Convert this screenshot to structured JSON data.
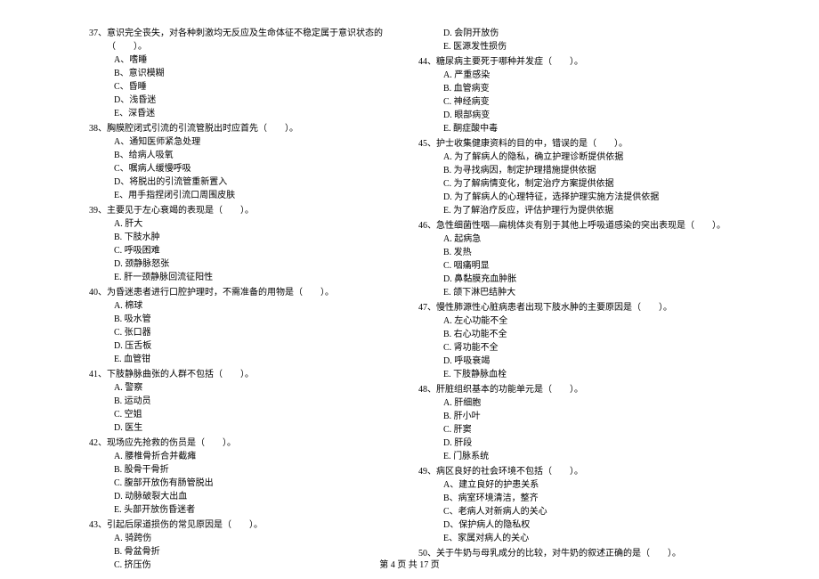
{
  "footer": "第 4 页 共 17 页",
  "left_column": [
    {
      "num": "37、",
      "text": "意识完全丧失，对各种刺激均无反应及生命体征不稳定属于意识状态的（　　）。",
      "options": [
        "A、嗜睡",
        "B、意识模糊",
        "C、昏睡",
        "D、浅昏迷",
        "E、深昏迷"
      ]
    },
    {
      "num": "38、",
      "text": "胸膜腔闭式引流的引流管脱出时应首先（　　）。",
      "options": [
        "A、通知医师紧急处理",
        "B、给病人吸氧",
        "C、嘱病人缓慢呼吸",
        "D、将脱出的引流管重新置入",
        "E、用手指捏闭引流口周围皮肤"
      ]
    },
    {
      "num": "39、",
      "text": "主要见于左心衰竭的表现是（　　）。",
      "options": [
        "A. 肝大",
        "B. 下肢水肿",
        "C. 呼吸困难",
        "D. 颈静脉怒张",
        "E. 肝一颈静脉回流征阳性"
      ]
    },
    {
      "num": "40、",
      "text": "为昏迷患者进行口腔护理时，不需准备的用物是（　　）。",
      "options": [
        "A. 棉球",
        "B. 吸水管",
        "C. 张口器",
        "D. 压舌板",
        "E. 血管钳"
      ]
    },
    {
      "num": "41、",
      "text": "下肢静脉曲张的人群不包括（　　）。",
      "options": [
        "A. 警察",
        "B. 运动员",
        "C. 空姐",
        "D. 医生"
      ]
    },
    {
      "num": "42、",
      "text": "现场应先抢救的伤员是（　　）。",
      "options": [
        "A. 腰椎骨折合并截瘫",
        "B. 股骨干骨折",
        "C. 腹部开放伤有肠管脱出",
        "D. 动脉破裂大出血",
        "E. 头部开放伤昏迷者"
      ]
    },
    {
      "num": "43、",
      "text": "引起后尿道损伤的常见原因是（　　）。",
      "options": [
        "A. 骑跨伤",
        "B. 骨盆骨折",
        "C. 挤压伤"
      ]
    }
  ],
  "right_column": [
    {
      "num": "",
      "text": "",
      "options": [
        "D. 会阴开放伤",
        "E. 医源发性损伤"
      ]
    },
    {
      "num": "44、",
      "text": "糖尿病主要死于哪种并发症（　　）。",
      "options": [
        "A. 严重感染",
        "B. 血管病变",
        "C. 神经病变",
        "D. 眼部病变",
        "E. 酮症酸中毒"
      ]
    },
    {
      "num": "45、",
      "text": "护士收集健康资料的目的中，错误的是（　　）。",
      "options": [
        "A. 为了解病人的隐私，确立护理诊断提供依据",
        "B. 为寻找病因，制定护理措施提供依据",
        "C. 为了解病情变化，制定治疗方案提供依据",
        "D. 为了解病人的心理特征，选择护理实施方法提供依据",
        "E. 为了解治疗反应，评估护理行为提供依据"
      ]
    },
    {
      "num": "46、",
      "text": "急性细菌性咽—扁桃体炎有别于其他上呼吸道感染的突出表现是（　　）。",
      "options": [
        "A. 起病急",
        "B. 发热",
        "C. 咽痛明显",
        "D. 鼻黏膜充血肿胀",
        "E. 颌下淋巴结肿大"
      ]
    },
    {
      "num": "47、",
      "text": "慢性肺源性心脏病患者出现下肢水肿的主要原因是（　　）。",
      "options": [
        "A. 左心功能不全",
        "B. 右心功能不全",
        "C. 肾功能不全",
        "D. 呼吸衰竭",
        "E. 下肢静脉血栓"
      ]
    },
    {
      "num": "48、",
      "text": "肝脏组织基本的功能单元是（　　）。",
      "options": [
        "A. 肝细胞",
        "B. 肝小叶",
        "C. 肝窦",
        "D. 肝段",
        "E. 门脉系统"
      ]
    },
    {
      "num": "49、",
      "text": "病区良好的社会环境不包括（　　）。",
      "options": [
        "A、建立良好的护患关系",
        "B、病室环境清洁，整齐",
        "C、老病人对新病人的关心",
        "D、保护病人的隐私权",
        "E、家属对病人的关心"
      ]
    },
    {
      "num": "50、",
      "text": "关于牛奶与母乳成分的比较，对牛奶的叙述正确的是（　　）。",
      "options": []
    }
  ]
}
